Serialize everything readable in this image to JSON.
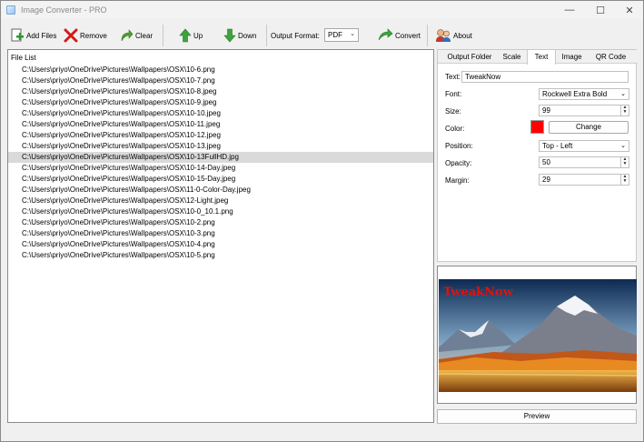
{
  "window": {
    "title": "Image Converter - PRO"
  },
  "toolbar": {
    "add_files": "Add Files",
    "remove": "Remove",
    "clear": "Clear",
    "up": "Up",
    "down": "Down",
    "output_format_label": "Output Format:",
    "output_format_value": "PDF",
    "convert": "Convert",
    "about": "About"
  },
  "file_list": {
    "header": "File List",
    "selected_index": 9,
    "files": [
      "C:\\Users\\priyo\\OneDrive\\Pictures\\Wallpapers\\OSX\\10-6.png",
      "C:\\Users\\priyo\\OneDrive\\Pictures\\Wallpapers\\OSX\\10-7.png",
      "C:\\Users\\priyo\\OneDrive\\Pictures\\Wallpapers\\OSX\\10-8.jpeg",
      "C:\\Users\\priyo\\OneDrive\\Pictures\\Wallpapers\\OSX\\10-9.jpeg",
      "C:\\Users\\priyo\\OneDrive\\Pictures\\Wallpapers\\OSX\\10-10.jpeg",
      "C:\\Users\\priyo\\OneDrive\\Pictures\\Wallpapers\\OSX\\10-11.jpeg",
      "C:\\Users\\priyo\\OneDrive\\Pictures\\Wallpapers\\OSX\\10-12.jpeg",
      "C:\\Users\\priyo\\OneDrive\\Pictures\\Wallpapers\\OSX\\10-13.jpeg",
      "C:\\Users\\priyo\\OneDrive\\Pictures\\Wallpapers\\OSX\\10-13FullHD.jpg",
      "C:\\Users\\priyo\\OneDrive\\Pictures\\Wallpapers\\OSX\\10-14-Day.jpeg",
      "C:\\Users\\priyo\\OneDrive\\Pictures\\Wallpapers\\OSX\\10-15-Day.jpeg",
      "C:\\Users\\priyo\\OneDrive\\Pictures\\Wallpapers\\OSX\\11-0-Color-Day.jpeg",
      "C:\\Users\\priyo\\OneDrive\\Pictures\\Wallpapers\\OSX\\12-Light.jpeg",
      "C:\\Users\\priyo\\OneDrive\\Pictures\\Wallpapers\\OSX\\10-0_10.1.png",
      "C:\\Users\\priyo\\OneDrive\\Pictures\\Wallpapers\\OSX\\10-2.png",
      "C:\\Users\\priyo\\OneDrive\\Pictures\\Wallpapers\\OSX\\10-3.png",
      "C:\\Users\\priyo\\OneDrive\\Pictures\\Wallpapers\\OSX\\10-4.png",
      "C:\\Users\\priyo\\OneDrive\\Pictures\\Wallpapers\\OSX\\10-5.png"
    ]
  },
  "tabs": [
    "Output Folder",
    "Scale",
    "Text",
    "Image",
    "QR Code"
  ],
  "active_tab": "Text",
  "text_settings": {
    "text_label": "Text:",
    "text_value": "TweakNow",
    "font_label": "Font:",
    "font_value": "Rockwell Extra Bold",
    "size_label": "Size:",
    "size_value": "99",
    "color_label": "Color:",
    "color_value": "#ff0000",
    "change_button": "Change",
    "position_label": "Position:",
    "position_value": "Top - Left",
    "opacity_label": "Opacity:",
    "opacity_value": "50",
    "margin_label": "Margin:",
    "margin_value": "29"
  },
  "preview": {
    "overlay_text": "TweakNow",
    "button": "Preview"
  }
}
